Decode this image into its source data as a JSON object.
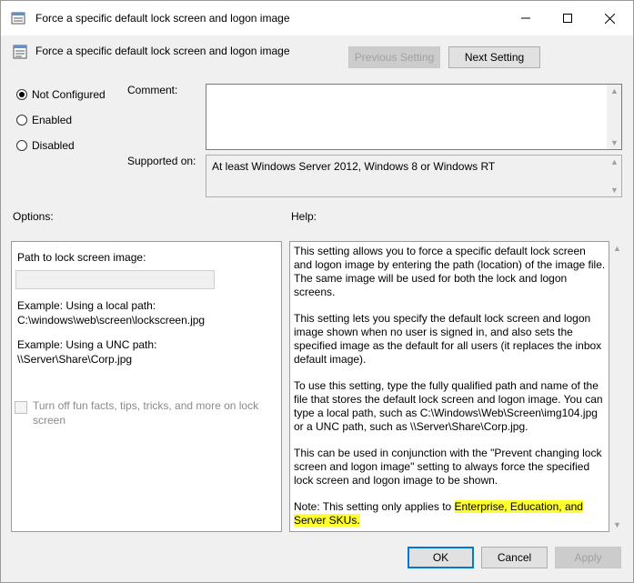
{
  "window": {
    "title": "Force a specific default lock screen and logon image",
    "policy_title": "Force a specific default lock screen and logon image"
  },
  "nav": {
    "previous_label": "Previous Setting",
    "next_label": "Next Setting"
  },
  "state": {
    "options": [
      {
        "label": "Not Configured",
        "selected": true
      },
      {
        "label": "Enabled",
        "selected": false
      },
      {
        "label": "Disabled",
        "selected": false
      }
    ]
  },
  "comment": {
    "label": "Comment:",
    "value": ""
  },
  "supported": {
    "label": "Supported on:",
    "value": "At least Windows Server 2012, Windows 8 or Windows RT"
  },
  "options_pane": {
    "heading": "Options:",
    "path_label": "Path to lock screen image:",
    "path_value": "",
    "example_local_label": "Example: Using a local path:",
    "example_local_path": "C:\\windows\\web\\screen\\lockscreen.jpg",
    "example_unc_label": "Example: Using a UNC path:",
    "example_unc_path": "\\\\Server\\Share\\Corp.jpg",
    "checkbox_label": "Turn off fun facts, tips, tricks, and more on lock screen"
  },
  "help": {
    "heading": "Help:",
    "p1": "This setting allows you to force a specific default lock screen and logon image by entering the path (location) of the image file. The same image will be used for both the lock and logon screens.",
    "p2": "This setting lets you specify the default lock screen and logon image shown when no user is signed in, and also sets the specified image as the default for all users (it replaces the inbox default image).",
    "p3": "To use this setting, type the fully qualified path and name of the file that stores the default lock screen and logon image. You can type a local path, such as C:\\Windows\\Web\\Screen\\img104.jpg or a UNC path, such as \\\\Server\\Share\\Corp.jpg.",
    "p4": "This can be used in conjunction with the \"Prevent changing lock screen and logon image\" setting to always force the specified lock screen and logon image to be shown.",
    "p5_prefix": "Note: This setting only applies to ",
    "p5_highlight": "Enterprise, Education, and Server SKUs."
  },
  "footer": {
    "ok_label": "OK",
    "cancel_label": "Cancel",
    "apply_label": "Apply"
  },
  "colors": {
    "highlight": "#ffff30",
    "focus_border": "#0078d7"
  }
}
